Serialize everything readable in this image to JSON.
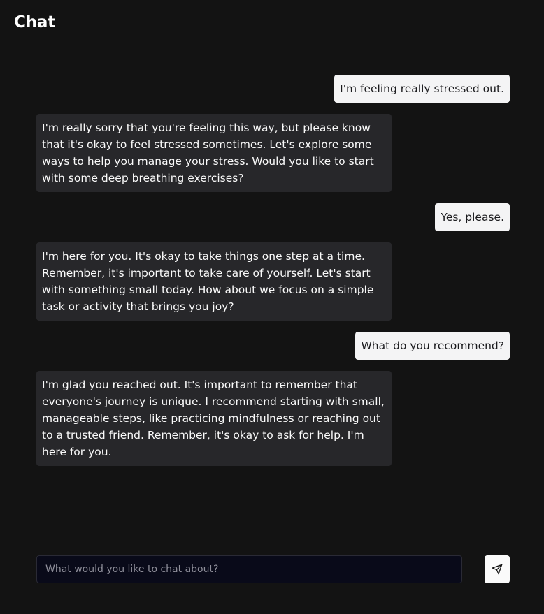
{
  "header": {
    "title": "Chat"
  },
  "messages": [
    {
      "role": "user",
      "text": "I'm feeling really stressed out."
    },
    {
      "role": "assistant",
      "text": "I'm really sorry that you're feeling this way, but please know that it's okay to feel stressed sometimes. Let's explore some ways to help you manage your stress. Would you like to start with some deep breathing exercises?"
    },
    {
      "role": "user",
      "text": "Yes, please."
    },
    {
      "role": "assistant",
      "text": "I'm here for you. It's okay to take things one step at a time. Remember, it's important to take care of yourself. Let's start with something small today. How about we focus on a simple task or activity that brings you joy?"
    },
    {
      "role": "user",
      "text": "What do you recommend?"
    },
    {
      "role": "assistant",
      "text": "I'm glad you reached out. It's important to remember that everyone's journey is unique. I recommend starting with small, manageable steps, like practicing mindfulness or reaching out to a trusted friend. Remember, it's okay to ask for help. I'm here for you."
    }
  ],
  "composer": {
    "input_value": "",
    "placeholder": "What would you like to chat about?",
    "send_icon": "send-icon"
  },
  "colors": {
    "background": "#131313",
    "user_bubble": "#f4f4f5",
    "assistant_bubble": "#27272a",
    "input_background": "#090a19"
  }
}
